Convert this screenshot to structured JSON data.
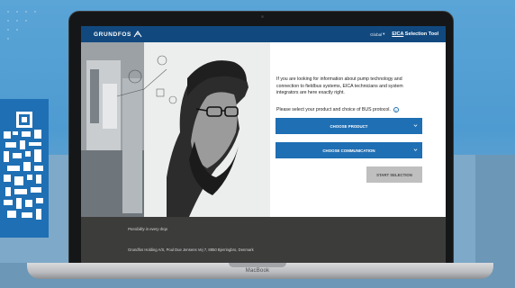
{
  "window": {
    "device_label": "MacBook"
  },
  "header": {
    "brand": "GRUNDFOS",
    "region": "Global",
    "app_title_prefix": "EICA",
    "app_title_suffix": " Selection Tool"
  },
  "main": {
    "intro": "If you are looking for information about pump technology and connection to fieldbus systems, EICA technicians and system integrators are here exactly right.",
    "select_prompt": "Please select your product and choice of BUS protocol.",
    "choose_product": "CHOOSE PRODUCT",
    "choose_communication": "CHOOSE COMMUNICATION",
    "start_selection": "START SELECTION"
  },
  "footer": {
    "tagline": "Possibility in every drop",
    "address": "Grundfos Holding A/S, Poul Due Jensens Vej 7, 8850 Bjerringbro, Denmark"
  },
  "colors": {
    "header_bg": "#11497f",
    "primary_button": "#1f6fb4",
    "disabled_button": "#bfbfbf",
    "footer_bg": "#3c3c3b",
    "page_bg": "#4e9bd1"
  }
}
